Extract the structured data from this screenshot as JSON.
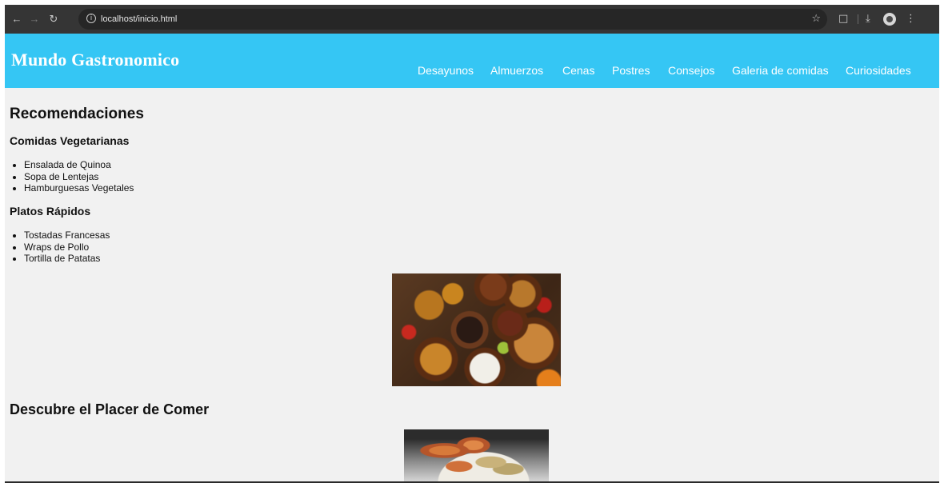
{
  "browser": {
    "url": "localhost/inicio.html",
    "icons": {
      "back": "arrow-left-icon",
      "forward": "arrow-right-icon",
      "reload": "reload-icon",
      "site_info": "info-icon",
      "bookmark": "star-icon",
      "extensions": "puzzle-icon",
      "downloads": "download-icon",
      "profile": "avatar",
      "menu": "kebab-menu-icon"
    }
  },
  "site": {
    "title": "Mundo Gastronomico",
    "nav": [
      "Desayunos",
      "Almuerzos",
      "Cenas",
      "Postres",
      "Consejos",
      "Galeria de comidas",
      "Curiosidades"
    ],
    "header_color": "#35c6f4"
  },
  "content": {
    "recomendaciones": {
      "heading": "Recomendaciones",
      "groups": [
        {
          "title": "Comidas Vegetarianas",
          "items": [
            "Ensalada de Quinoa",
            "Sopa de Lentejas",
            "Hamburguesas Vegetales"
          ]
        },
        {
          "title": "Platos Rápidos",
          "items": [
            "Tostadas Francesas",
            "Wraps de Pollo",
            "Tortilla de Patatas"
          ]
        }
      ]
    },
    "descubre": {
      "heading": "Descubre el Placer de Comer"
    }
  }
}
